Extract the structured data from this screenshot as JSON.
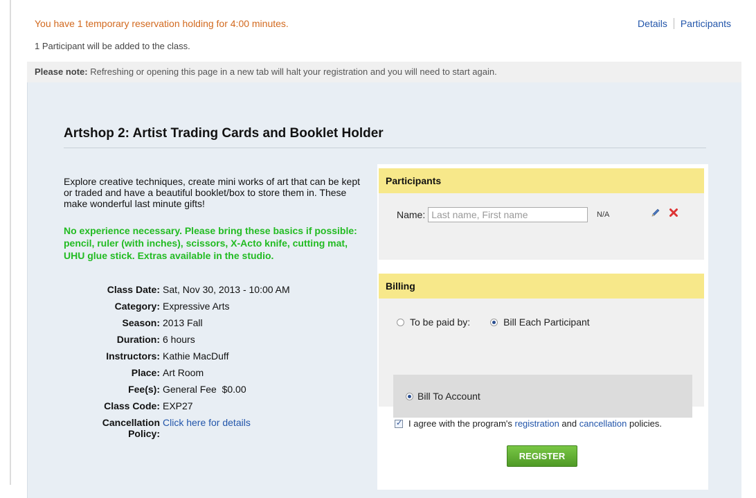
{
  "banner": {
    "reservation_text": "You have 1 temporary reservation holding for 4:00 minutes.",
    "participants_added": "1 Participant will be added to the class."
  },
  "top_links": {
    "details": "Details",
    "participants": "Participants"
  },
  "note": {
    "label": "Please note:",
    "text": " Refreshing or opening this page in a new tab will halt your registration and you will need to start again."
  },
  "class": {
    "title": "Artshop 2: Artist Trading Cards and Booklet Holder",
    "description": "Explore creative techniques, create mini works of art that can be kept or traded and have a beautiful booklet/box to store them in. These make wonderful last minute gifts!",
    "requirements": "No experience necessary. Please bring these basics if possible: pencil, ruler (with inches), scissors, X-Acto knife, cutting mat, UHU glue stick. Extras available in the studio.",
    "details": {
      "class_date": {
        "label": "Class Date:",
        "value": "Sat, Nov 30, 2013 - 10:00 AM"
      },
      "category": {
        "label": "Category:",
        "value": "Expressive Arts"
      },
      "season": {
        "label": "Season:",
        "value": "2013 Fall"
      },
      "duration": {
        "label": "Duration:",
        "value": "6 hours"
      },
      "instructors": {
        "label": "Instructors:",
        "value": "Kathie MacDuff"
      },
      "place": {
        "label": "Place:",
        "value": "Art Room"
      },
      "fees": {
        "label": "Fee(s):",
        "value": "General Fee  $0.00"
      },
      "class_code": {
        "label": "Class Code:",
        "value": "EXP27"
      },
      "cancellation": {
        "label_1": "Cancellation",
        "label_2": "Policy:",
        "link": "Click here for details"
      }
    }
  },
  "participants_section": {
    "heading": "Participants",
    "name_label": "Name:",
    "name_placeholder": "Last name, First name",
    "na": "N/A",
    "icons": {
      "edit": "pencil-icon",
      "remove": "x-icon"
    }
  },
  "billing_section": {
    "heading": "Billing",
    "to_be_paid_by": "To be paid by:",
    "bill_each": "Bill Each Participant",
    "bill_account": "Bill To Account"
  },
  "agreement": {
    "prefix": "I agree with the program's ",
    "registration_link": "registration",
    "and": " and ",
    "cancellation_link": "cancellation",
    "suffix": " policies.",
    "checked": true
  },
  "register_button": "REGISTER",
  "colors": {
    "reservation_text": "#d2691e",
    "link": "#2255aa",
    "requirements": "#22bb22",
    "section_header": "#f7e88a",
    "register_button": "#5faa30"
  }
}
